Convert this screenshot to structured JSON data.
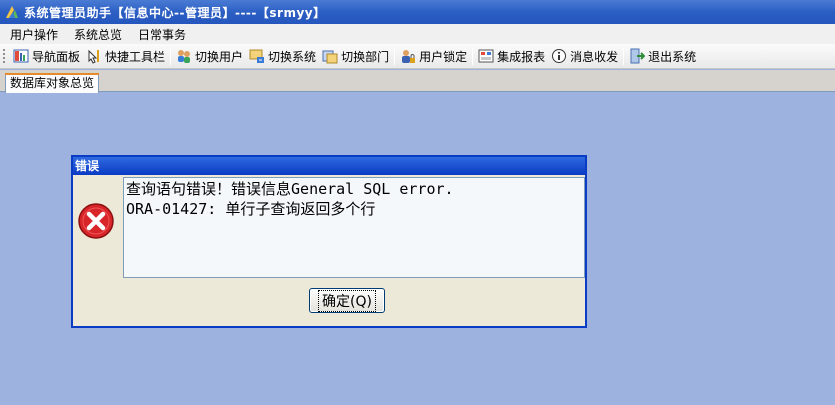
{
  "window": {
    "title": "系统管理员助手【信息中心--管理员】----【srmyy】"
  },
  "menu": {
    "items": [
      "用户操作",
      "系统总览",
      "日常事务"
    ]
  },
  "toolbar": {
    "items": [
      {
        "label": "导航面板",
        "icon": "nav-panel-icon"
      },
      {
        "label": "快捷工具栏",
        "icon": "quick-toolbar-icon"
      },
      {
        "label": "切换用户",
        "icon": "switch-user-icon"
      },
      {
        "label": "切换系统",
        "icon": "switch-system-icon"
      },
      {
        "label": "切换部门",
        "icon": "switch-department-icon"
      },
      {
        "label": "用户锁定",
        "icon": "user-lock-icon"
      },
      {
        "label": "集成报表",
        "icon": "report-icon"
      },
      {
        "label": "消息收发",
        "icon": "message-icon"
      },
      {
        "label": "退出系统",
        "icon": "exit-icon"
      }
    ]
  },
  "tabs": {
    "active": "数据库对象总览"
  },
  "dialog": {
    "title": "错误",
    "message": "查询语句错误！错误信息General SQL error.\nORA-01427: 单行子查询返回多个行",
    "ok_label": "确定(Q)",
    "icon": "error-icon"
  },
  "colors": {
    "titlebar": "#2c5fc4",
    "workspace": "#9db2de",
    "dialog_border": "#0a3bc4",
    "error_red": "#d8252a"
  }
}
